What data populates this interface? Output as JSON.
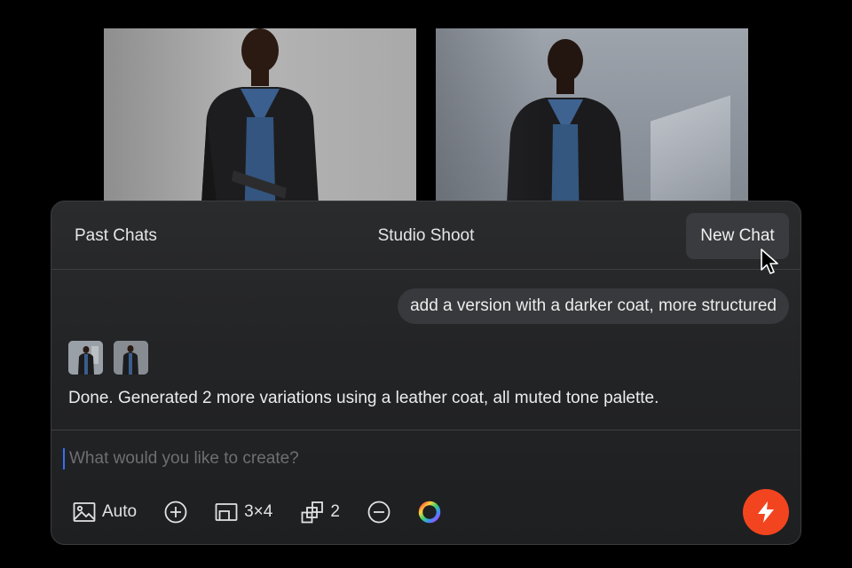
{
  "header": {
    "left_label": "Past Chats",
    "title": "Studio Shoot",
    "new_chat_label": "New Chat"
  },
  "conversation": {
    "user_message": "add a version with a darker coat, more structured",
    "assistant_reply": "Done. Generated 2 more variations using a leather coat, all muted tone palette.",
    "thumbnails": [
      "thumbnail-1",
      "thumbnail-2"
    ]
  },
  "composer": {
    "placeholder": "What would you like to create?",
    "value": ""
  },
  "toolbar": {
    "image_mode_label": "Auto",
    "aspect_ratio_label": "3×4",
    "count_label": "2"
  },
  "icons": {
    "image": "image-icon",
    "add": "plus-circle-icon",
    "aspect": "aspect-ratio-icon",
    "copies": "copies-icon",
    "remove": "minus-circle-icon",
    "color": "color-wheel-icon",
    "send": "lightning-icon"
  },
  "colors": {
    "accent": "#f2451f",
    "panel": "#232426",
    "caret": "#3b6cf5"
  }
}
